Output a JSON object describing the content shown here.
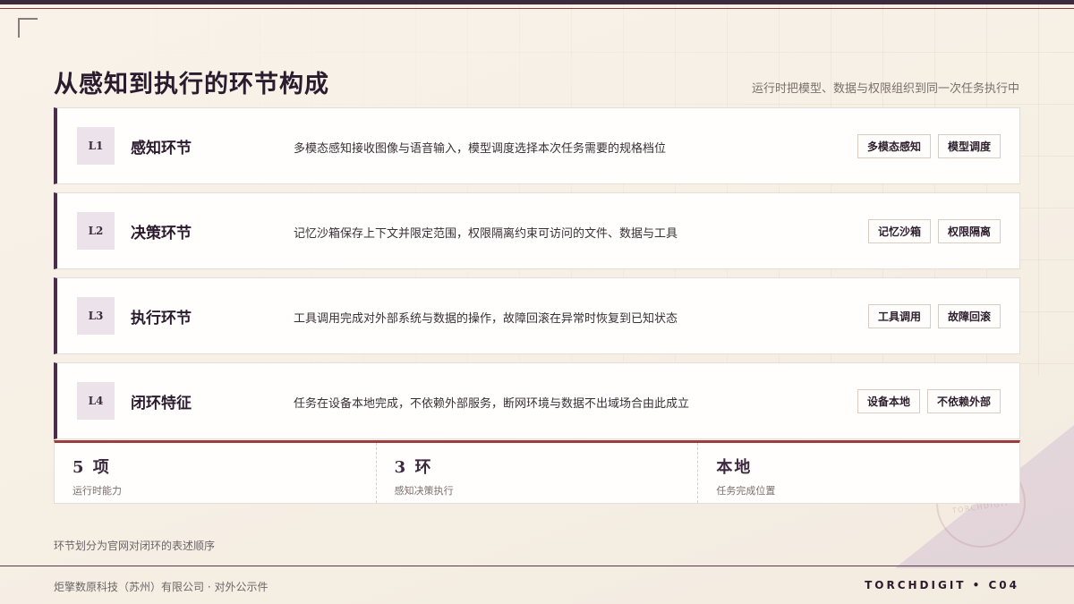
{
  "header": {
    "title": "从感知到执行的环节构成",
    "subtitle": "运行时把模型、数据与权限组织到同一次任务执行中"
  },
  "layers": [
    {
      "badge": "L1",
      "title": "感知环节",
      "description": "多模态感知接收图像与语音输入，模型调度选择本次任务需要的规格档位",
      "tags": [
        "多模态感知",
        "模型调度"
      ]
    },
    {
      "badge": "L2",
      "title": "决策环节",
      "description": "记忆沙箱保存上下文并限定范围，权限隔离约束可访问的文件、数据与工具",
      "tags": [
        "记忆沙箱",
        "权限隔离"
      ]
    },
    {
      "badge": "L3",
      "title": "执行环节",
      "description": "工具调用完成对外部系统与数据的操作，故障回滚在异常时恢复到已知状态",
      "tags": [
        "工具调用",
        "故障回滚"
      ]
    },
    {
      "badge": "L4",
      "title": "闭环特征",
      "description": "任务在设备本地完成，不依赖外部服务，断网环境与数据不出域场合由此成立",
      "tags": [
        "设备本地",
        "不依赖外部"
      ]
    }
  ],
  "stats": [
    {
      "value": "5 项",
      "label": "运行时能力"
    },
    {
      "value": "3 环",
      "label": "感知决策执行"
    },
    {
      "value": "本地",
      "label": "任务完成位置"
    }
  ],
  "footnote": "环节划分为官网对闭环的表述顺序",
  "footer": {
    "company": "炬擎数原科技（苏州）有限公司 · 对外公示件",
    "brand": "TORCHDIGIT • C04"
  },
  "stamp_text": "TORCHDIGIT",
  "colors": {
    "accent": "#4a2d4b",
    "accent_red": "#9b3d3a",
    "background": "#f8f2e9",
    "badge_bg": "#ece3ea"
  }
}
